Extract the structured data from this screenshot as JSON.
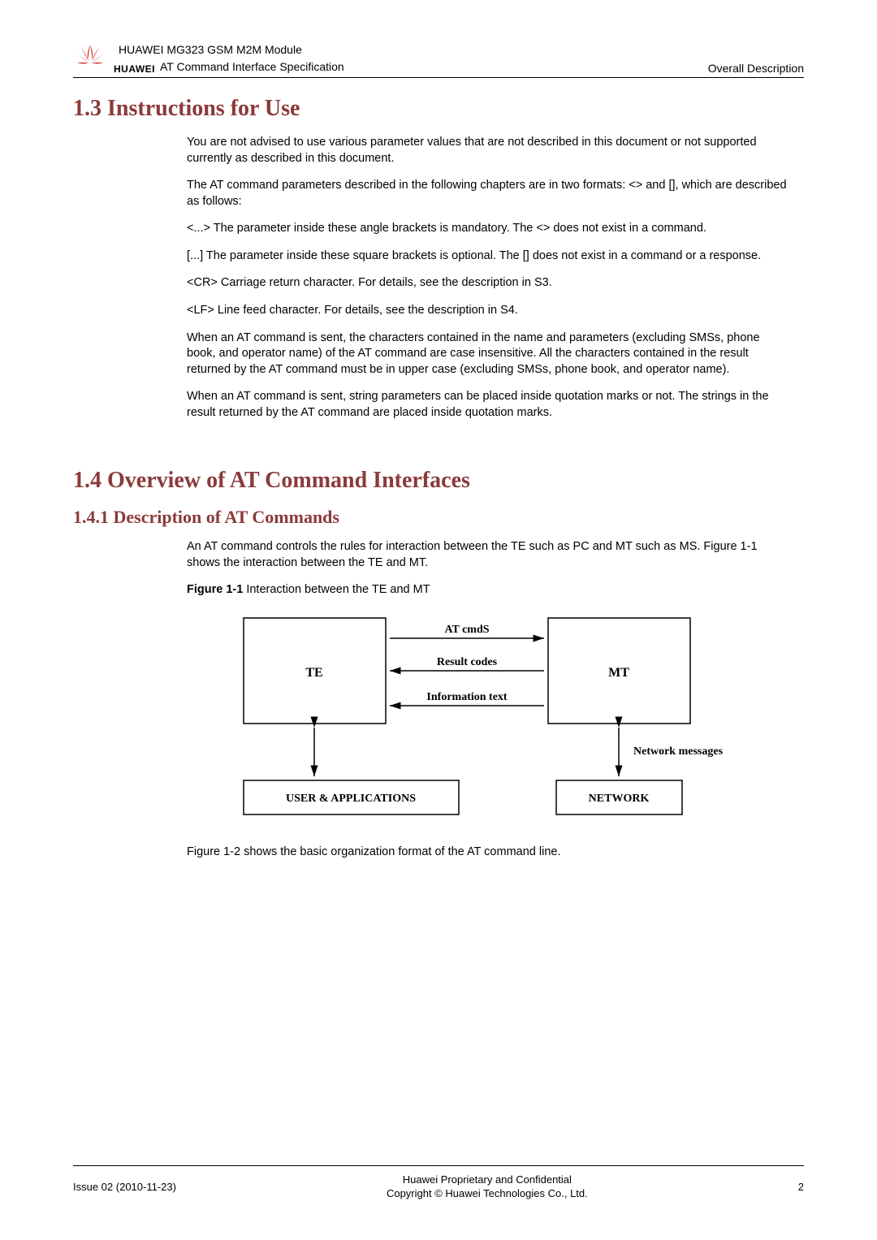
{
  "header": {
    "logo_text": "HUAWEI",
    "line1": "HUAWEI MG323 GSM M2M Module",
    "line2": "AT Command Interface Specification",
    "right": "Overall Description"
  },
  "section_1_3": {
    "title": "1.3 Instructions for Use",
    "p1": "You are not advised to use various parameter values that are not described in this document or not supported currently as described in this document.",
    "p2": "The AT command parameters described in the following chapters are in two formats: <> and [], which are described as follows:",
    "p3": "<...>      The parameter inside these angle brackets is mandatory. The <> does not exist in a command.",
    "p4": "[...]         The parameter inside these square brackets is optional. The [] does not exist in a command or a response.",
    "p5": "<CR>     Carriage return character. For details, see the description in S3.",
    "p6": "<LF>      Line feed character. For details, see the description in S4.",
    "p7": "When an AT command is sent, the characters contained in the name and parameters (excluding SMSs, phone book, and operator name) of the AT command are case insensitive. All the characters contained in the result returned by the AT command must be in upper case (excluding SMSs, phone book, and operator name).",
    "p8": "When an AT command is sent, string parameters can be placed inside quotation marks or not. The strings in the result returned by the AT command are placed inside quotation marks."
  },
  "section_1_4": {
    "title": "1.4 Overview of AT Command Interfaces",
    "subtitle": "1.4.1 Description of AT Commands",
    "p1": "An AT command controls the rules for interaction between the TE such as PC and MT such as MS. Figure 1-1 shows the interaction between the TE and MT.",
    "figure_label": "Figure 1-1",
    "figure_caption": " Interaction between the TE and MT",
    "p2": "Figure 1-2 shows the basic organization format of the AT command line."
  },
  "diagram": {
    "te": "TE",
    "mt": "MT",
    "at_cmds": "AT cmdS",
    "result_codes": "Result codes",
    "info_text": "Information text",
    "network_messages": "Network messages",
    "user_apps": "USER & APPLICATIONS",
    "network": "NETWORK"
  },
  "footer": {
    "left": "Issue 02 (2010-11-23)",
    "center_line1": "Huawei Proprietary and Confidential",
    "center_line2": "Copyright © Huawei Technologies Co., Ltd.",
    "right": "2"
  }
}
